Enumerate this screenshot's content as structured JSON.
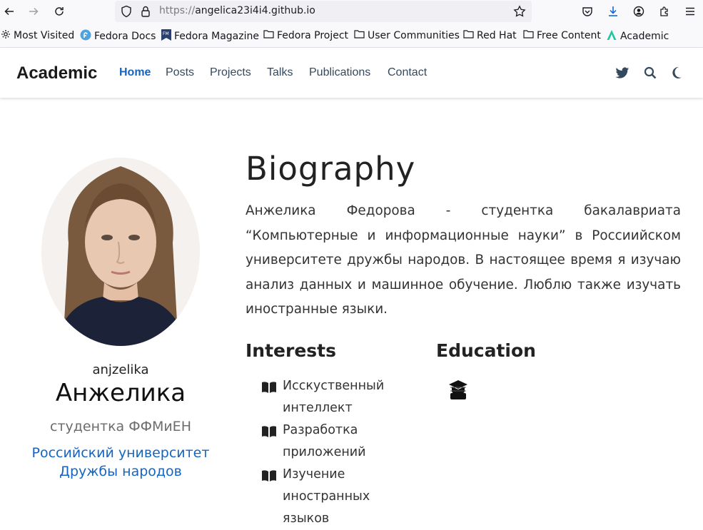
{
  "browser": {
    "url_scheme": "https://",
    "url_host": "angelica23i4i4.github.io",
    "bookmarks": [
      "Most Visited",
      "Fedora Docs",
      "Fedora Magazine",
      "Fedora Project",
      "User Communities",
      "Red Hat",
      "Free Content",
      "Academic"
    ]
  },
  "site": {
    "brand": "Academic",
    "nav": [
      "Home",
      "Posts",
      "Projects",
      "Talks",
      "Publications",
      "Contact"
    ],
    "active_nav": "Home",
    "accent_color": "#1565c0"
  },
  "profile": {
    "username": "anjzelika",
    "name": "Анжелика",
    "role": "студентка ФФМиЕН",
    "organization": "Российский университет Дружбы народов"
  },
  "biography": {
    "title": "Biography",
    "text": "Анжелика Федорова - студентка бакалавриата “Компьютерные и информационные науки” в Россиийском университете дружбы народов. В настоящее время я изучаю анализ данных и машинное обучение. Люблю также изучать иностранные языки."
  },
  "interests": {
    "title": "Interests",
    "items": [
      "Исскуственный интеллект",
      "Разработка приложений",
      "Изучение иностранных языков"
    ]
  },
  "education": {
    "title": "Education"
  }
}
